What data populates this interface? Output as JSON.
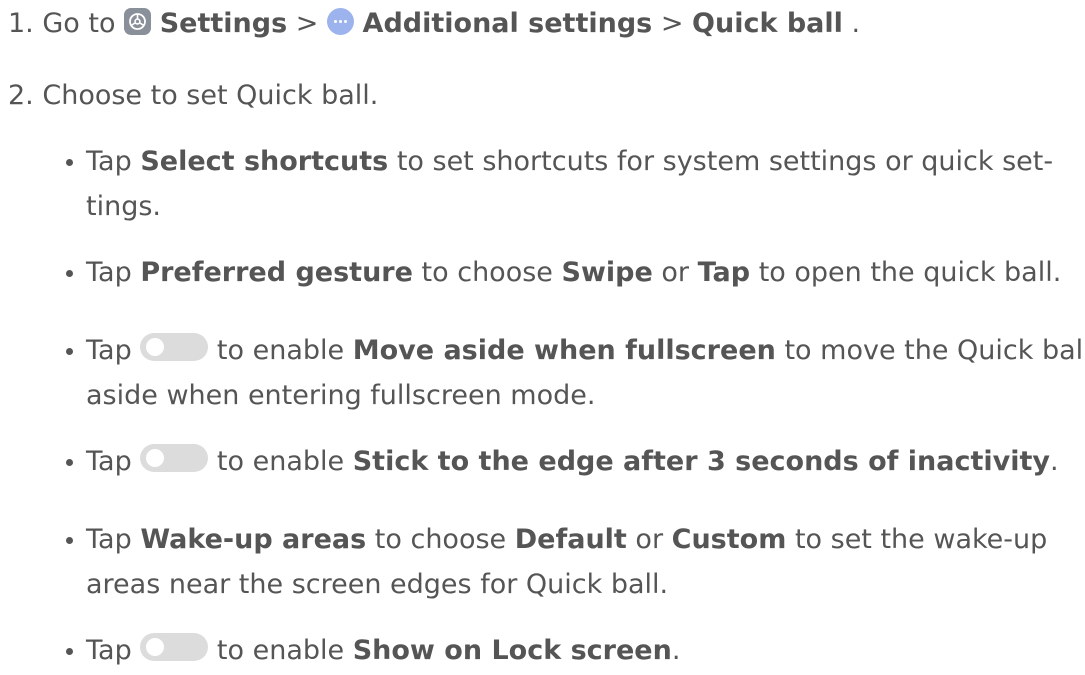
{
  "step1": {
    "number": "1.",
    "prefix": "Go to",
    "settings": "Settings",
    "sep1": ">",
    "additional": "Additional settings",
    "sep2": ">",
    "quick_ball": "Quick ball",
    "end": "."
  },
  "step2": {
    "number": "2.",
    "text": "Choose to set Quick ball."
  },
  "bullets": {
    "b1": {
      "tap": "Tap",
      "bold": "Select shortcuts",
      "rest1": "to set shortcuts for system settings or quick set-",
      "rest2": "tings."
    },
    "b2": {
      "tap": "Tap",
      "bold1": "Preferred gesture",
      "t1": "to choose",
      "bold2": "Swipe",
      "t2": "or",
      "bold3": "Tap",
      "t3": "to open the quick ball."
    },
    "b3": {
      "tap": "Tap",
      "t1": "to enable",
      "bold": "Move aside when fullscreen",
      "t2": "to move the Quick ball",
      "line2": "aside when entering fullscreen mode."
    },
    "b4": {
      "tap": "Tap",
      "t1": "to enable",
      "bold": "Stick to the edge after 3 seconds of inactivity",
      "end": "."
    },
    "b5": {
      "tap": "Tap",
      "bold1": "Wake-up areas",
      "t1": "to choose",
      "bold2": "Default",
      "t2": "or",
      "bold3": "Custom",
      "t3": "to set the wake-up",
      "line2": "areas near the screen edges for Quick ball."
    },
    "b6": {
      "tap": "Tap",
      "t1": "to enable",
      "bold": "Show on Lock screen",
      "end": "."
    }
  },
  "icons": {
    "settings": "settings-icon",
    "additional": "more-dots-icon",
    "toggle": "toggle-switch-icon"
  },
  "colors": {
    "text": "#555555",
    "settings_icon_bg": "#8a9099",
    "more_icon_bg": "#9db3ee",
    "toggle_bg": "#dcdcdc"
  }
}
